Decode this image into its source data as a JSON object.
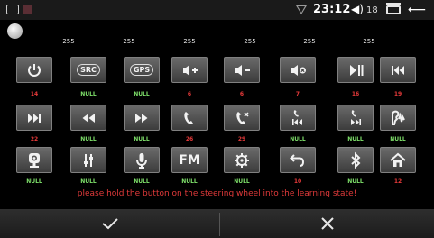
{
  "status": {
    "time": "23:12",
    "volume_icon": "speaker-icon",
    "volume_glyph": "◀))",
    "volume_level": "18",
    "back_glyph": "⟵"
  },
  "values": [
    "255",
    "255",
    "255",
    "255",
    "255",
    "255"
  ],
  "keys": [
    {
      "icon": "power-icon",
      "caption": "14",
      "caption_color": "red"
    },
    {
      "icon": "src-icon",
      "label": "SRC",
      "caption": "NULL",
      "caption_color": "green"
    },
    {
      "icon": "gps-icon",
      "label": "GPS",
      "caption": "NULL",
      "caption_color": "green"
    },
    {
      "icon": "volume-up-icon",
      "caption": "6",
      "caption_color": "red"
    },
    {
      "icon": "volume-down-icon",
      "caption": "6",
      "caption_color": "red"
    },
    {
      "icon": "mute-icon",
      "caption": "7",
      "caption_color": "red"
    },
    {
      "icon": "play-pause-icon",
      "caption": "16",
      "caption_color": "red"
    },
    {
      "icon": "previous-track-icon",
      "caption": "19",
      "caption_color": "red"
    },
    {
      "icon": "next-track-icon",
      "caption": "22",
      "caption_color": "red"
    },
    {
      "icon": "rewind-icon",
      "caption": "NULL",
      "caption_color": "green"
    },
    {
      "icon": "fast-forward-icon",
      "caption": "NULL",
      "caption_color": "green"
    },
    {
      "icon": "call-answer-icon",
      "caption": "26",
      "caption_color": "red"
    },
    {
      "icon": "call-hangup-icon",
      "caption": "29",
      "caption_color": "red"
    },
    {
      "icon": "call-previous-icon",
      "caption": "NULL",
      "caption_color": "green"
    },
    {
      "icon": "call-next-icon",
      "caption": "NULL",
      "caption_color": "green"
    },
    {
      "icon": "voice-command-icon",
      "caption": "NULL",
      "caption_color": "green"
    },
    {
      "icon": "camera-icon",
      "caption": "NULL",
      "caption_color": "green"
    },
    {
      "icon": "equalizer-icon",
      "caption": "NULL",
      "caption_color": "green"
    },
    {
      "icon": "microphone-icon",
      "caption": "NULL",
      "caption_color": "green"
    },
    {
      "icon": "fm-icon",
      "label": "FM",
      "caption": "NULL",
      "caption_color": "green"
    },
    {
      "icon": "settings-icon",
      "caption": "NULL",
      "caption_color": "green"
    },
    {
      "icon": "return-icon",
      "caption": "10",
      "caption_color": "red"
    },
    {
      "icon": "bluetooth-icon",
      "caption": "NULL",
      "caption_color": "green"
    },
    {
      "icon": "home-icon",
      "caption": "12",
      "caption_color": "red"
    }
  ],
  "hint": "please hold the button on the steering wheel into the learning state!",
  "confirm_icon": "checkmark-icon",
  "cancel_icon": "close-icon",
  "colors": {
    "red": "#e83a3a",
    "green": "#7ee06a",
    "hint": "#e03a3a"
  }
}
